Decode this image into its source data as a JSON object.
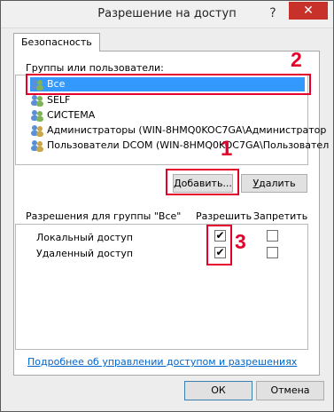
{
  "window": {
    "title": "Разрешение на доступ",
    "help_label": "?",
    "close_label": "✕"
  },
  "tab": {
    "label": "Безопасность"
  },
  "groups": {
    "label": "Группы или пользователи:",
    "items": [
      {
        "label": "Все",
        "selected": true
      },
      {
        "label": "SELF"
      },
      {
        "label": "СИСТЕМА"
      },
      {
        "label": "Администраторы (WIN-8HMQ0KOC7GA\\Администратор"
      },
      {
        "label": "Пользователи DCOM (WIN-8HMQ0KOC7GA\\Пользовател"
      }
    ]
  },
  "buttons": {
    "add_prefix": "Д",
    "add_rest": "обавить...",
    "remove_prefix": "У",
    "remove_rest": "далить",
    "ok": "ОК",
    "cancel": "Отмена"
  },
  "permissions": {
    "title": "Разрешения для группы \"Все\"",
    "allow_header": "Разрешить",
    "deny_header": "Запретить",
    "rows": [
      {
        "label": "Локальный доступ",
        "allow": true,
        "deny": false
      },
      {
        "label": "Удаленный доступ",
        "allow": true,
        "deny": false
      }
    ]
  },
  "link": {
    "text": "Подробнее об управлении доступом и разрешениях"
  },
  "annotations": {
    "n1": "1",
    "n2": "2",
    "n3": "3",
    "accent": "#e4002b"
  },
  "icons": [
    "users-icon",
    "check-icon"
  ]
}
